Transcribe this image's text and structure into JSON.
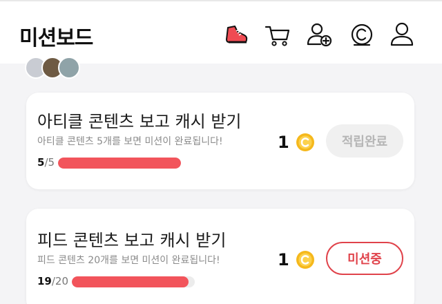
{
  "header": {
    "title": "미션보드",
    "icons": [
      "running-shoe-icon",
      "cart-icon",
      "add-friend-icon",
      "cash-coin-icon",
      "profile-icon"
    ]
  },
  "friends_row": {
    "text": ""
  },
  "missions": [
    {
      "title": "아티클 콘텐츠 보고 캐시 받기",
      "description": "아티클 콘텐츠 5개를 보면 미션이 완료됩니다!",
      "progress_current": "5",
      "progress_total": "/5",
      "progress_fraction": 1.0,
      "reward": "1",
      "button_label": "적립완료",
      "status": "completed"
    },
    {
      "title": "피드 콘텐츠 보고 캐시 받기",
      "description": "피드 콘텐츠 20개를 보면 미션이 완료됩니다!",
      "progress_current": "19",
      "progress_total": "/20",
      "progress_fraction": 0.95,
      "reward": "1",
      "button_label": "미션중",
      "status": "in-progress"
    }
  ],
  "colors": {
    "accent_red": "#e0424a",
    "progress_fill": "#f2545b",
    "coin_gold": "#f5b81c"
  }
}
